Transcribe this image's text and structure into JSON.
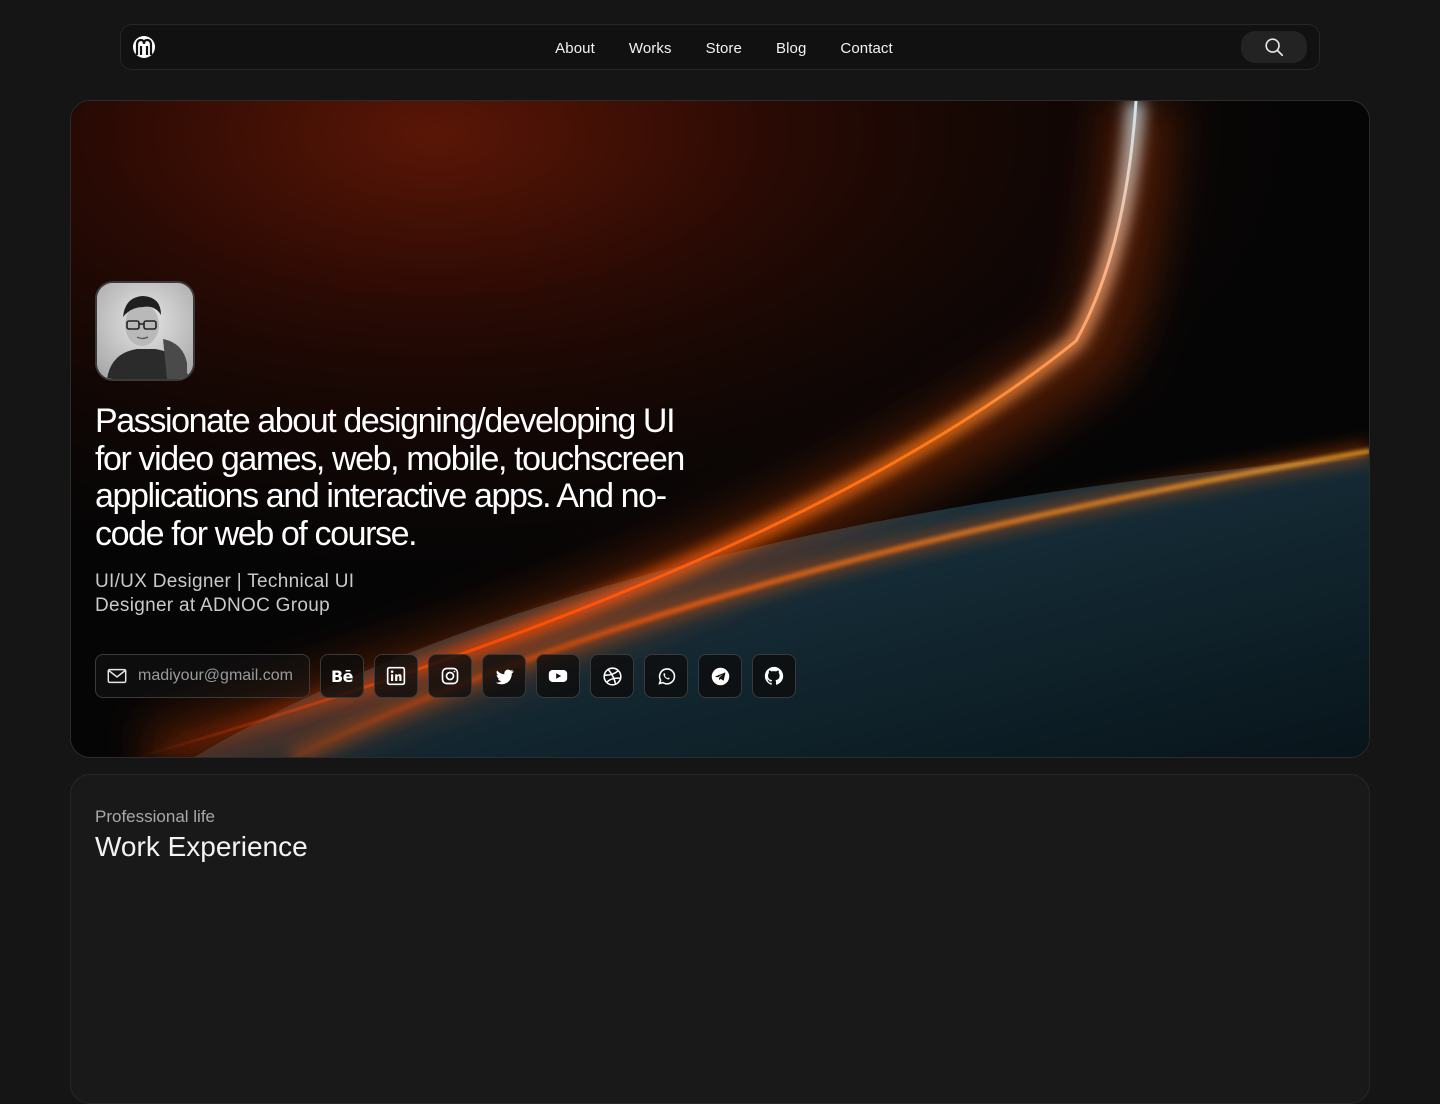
{
  "nav": {
    "logo_icon": "brand-logo-icon",
    "links": [
      "About",
      "Works",
      "Store",
      "Blog",
      "Contact"
    ],
    "search_icon": "search-icon"
  },
  "hero": {
    "avatar_icon": "profile-photo",
    "headline": "Passionate about designing/developing UI for video games, web, mobile, touchscreen applications and interactive apps. And no-code for web of course.",
    "subtitle": "UI/UX Designer | Technical UI Designer at ADNOC Group",
    "email": "madiyour@gmail.com",
    "email_icon": "mail-icon",
    "socials": [
      {
        "name": "behance",
        "icon": "behance-icon",
        "glyph": "Bē"
      },
      {
        "name": "linkedin",
        "icon": "linkedin-icon"
      },
      {
        "name": "instagram",
        "icon": "instagram-icon"
      },
      {
        "name": "twitter",
        "icon": "twitter-icon"
      },
      {
        "name": "youtube",
        "icon": "youtube-icon"
      },
      {
        "name": "dribbble",
        "icon": "dribbble-icon"
      },
      {
        "name": "whatsapp",
        "icon": "whatsapp-icon"
      },
      {
        "name": "telegram",
        "icon": "telegram-icon"
      },
      {
        "name": "github",
        "icon": "github-icon"
      }
    ]
  },
  "experience": {
    "kicker": "Professional life",
    "title": "Work Experience"
  },
  "colors": {
    "page_bg": "#151515",
    "card_bg": "#191919",
    "accent_orange": "#ff5a0a",
    "accent_teal": "#1f3a44"
  }
}
